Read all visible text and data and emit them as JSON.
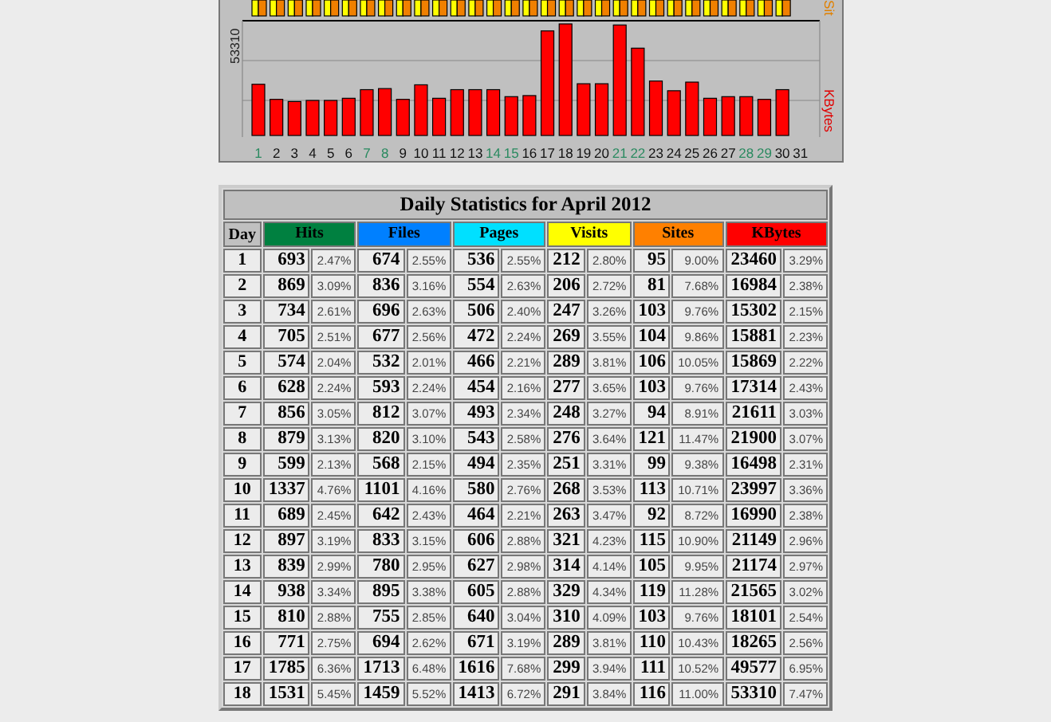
{
  "chart": {
    "y_label": "53310",
    "side_labels": [
      {
        "text": "Sit",
        "color": "#e08000"
      },
      {
        "text": "KBytes",
        "color": "#e00000"
      }
    ],
    "days": [
      {
        "label": "1",
        "weekend": true
      },
      {
        "label": "2",
        "weekend": false
      },
      {
        "label": "3",
        "weekend": false
      },
      {
        "label": "4",
        "weekend": false
      },
      {
        "label": "5",
        "weekend": false
      },
      {
        "label": "6",
        "weekend": false
      },
      {
        "label": "7",
        "weekend": true
      },
      {
        "label": "8",
        "weekend": true
      },
      {
        "label": "9",
        "weekend": false
      },
      {
        "label": "10",
        "weekend": false
      },
      {
        "label": "11",
        "weekend": false
      },
      {
        "label": "12",
        "weekend": false
      },
      {
        "label": "13",
        "weekend": false
      },
      {
        "label": "14",
        "weekend": true
      },
      {
        "label": "15",
        "weekend": true
      },
      {
        "label": "16",
        "weekend": false
      },
      {
        "label": "17",
        "weekend": false
      },
      {
        "label": "18",
        "weekend": false
      },
      {
        "label": "19",
        "weekend": false
      },
      {
        "label": "20",
        "weekend": false
      },
      {
        "label": "21",
        "weekend": true
      },
      {
        "label": "22",
        "weekend": true
      },
      {
        "label": "23",
        "weekend": false
      },
      {
        "label": "24",
        "weekend": false
      },
      {
        "label": "25",
        "weekend": false
      },
      {
        "label": "26",
        "weekend": false
      },
      {
        "label": "27",
        "weekend": false
      },
      {
        "label": "28",
        "weekend": true
      },
      {
        "label": "29",
        "weekend": true
      },
      {
        "label": "30",
        "weekend": false
      },
      {
        "label": "31",
        "weekend": false
      }
    ]
  },
  "table": {
    "title": "Daily Statistics for April 2012",
    "day_header": "Day",
    "columns": [
      {
        "label": "Hits",
        "color": "#008040",
        "colspan": 2
      },
      {
        "label": "Files",
        "color": "#0080ff",
        "colspan": 2
      },
      {
        "label": "Pages",
        "color": "#00e0ff",
        "colspan": 2
      },
      {
        "label": "Visits",
        "color": "#ffff00",
        "colspan": 2
      },
      {
        "label": "Sites",
        "color": "#ff8000",
        "colspan": 2
      },
      {
        "label": "KBytes",
        "color": "#ff0000",
        "colspan": 2
      }
    ],
    "rows": [
      {
        "day": "1",
        "cells": [
          "693",
          "2.47%",
          "674",
          "2.55%",
          "536",
          "2.55%",
          "212",
          "2.80%",
          "95",
          "9.00%",
          "23460",
          "3.29%"
        ]
      },
      {
        "day": "2",
        "cells": [
          "869",
          "3.09%",
          "836",
          "3.16%",
          "554",
          "2.63%",
          "206",
          "2.72%",
          "81",
          "7.68%",
          "16984",
          "2.38%"
        ]
      },
      {
        "day": "3",
        "cells": [
          "734",
          "2.61%",
          "696",
          "2.63%",
          "506",
          "2.40%",
          "247",
          "3.26%",
          "103",
          "9.76%",
          "15302",
          "2.15%"
        ]
      },
      {
        "day": "4",
        "cells": [
          "705",
          "2.51%",
          "677",
          "2.56%",
          "472",
          "2.24%",
          "269",
          "3.55%",
          "104",
          "9.86%",
          "15881",
          "2.23%"
        ]
      },
      {
        "day": "5",
        "cells": [
          "574",
          "2.04%",
          "532",
          "2.01%",
          "466",
          "2.21%",
          "289",
          "3.81%",
          "106",
          "10.05%",
          "15869",
          "2.22%"
        ]
      },
      {
        "day": "6",
        "cells": [
          "628",
          "2.24%",
          "593",
          "2.24%",
          "454",
          "2.16%",
          "277",
          "3.65%",
          "103",
          "9.76%",
          "17314",
          "2.43%"
        ]
      },
      {
        "day": "7",
        "cells": [
          "856",
          "3.05%",
          "812",
          "3.07%",
          "493",
          "2.34%",
          "248",
          "3.27%",
          "94",
          "8.91%",
          "21611",
          "3.03%"
        ]
      },
      {
        "day": "8",
        "cells": [
          "879",
          "3.13%",
          "820",
          "3.10%",
          "543",
          "2.58%",
          "276",
          "3.64%",
          "121",
          "11.47%",
          "21900",
          "3.07%"
        ]
      },
      {
        "day": "9",
        "cells": [
          "599",
          "2.13%",
          "568",
          "2.15%",
          "494",
          "2.35%",
          "251",
          "3.31%",
          "99",
          "9.38%",
          "16498",
          "2.31%"
        ]
      },
      {
        "day": "10",
        "cells": [
          "1337",
          "4.76%",
          "1101",
          "4.16%",
          "580",
          "2.76%",
          "268",
          "3.53%",
          "113",
          "10.71%",
          "23997",
          "3.36%"
        ]
      },
      {
        "day": "11",
        "cells": [
          "689",
          "2.45%",
          "642",
          "2.43%",
          "464",
          "2.21%",
          "263",
          "3.47%",
          "92",
          "8.72%",
          "16990",
          "2.38%"
        ]
      },
      {
        "day": "12",
        "cells": [
          "897",
          "3.19%",
          "833",
          "3.15%",
          "606",
          "2.88%",
          "321",
          "4.23%",
          "115",
          "10.90%",
          "21149",
          "2.96%"
        ]
      },
      {
        "day": "13",
        "cells": [
          "839",
          "2.99%",
          "780",
          "2.95%",
          "627",
          "2.98%",
          "314",
          "4.14%",
          "105",
          "9.95%",
          "21174",
          "2.97%"
        ]
      },
      {
        "day": "14",
        "cells": [
          "938",
          "3.34%",
          "895",
          "3.38%",
          "605",
          "2.88%",
          "329",
          "4.34%",
          "119",
          "11.28%",
          "21565",
          "3.02%"
        ]
      },
      {
        "day": "15",
        "cells": [
          "810",
          "2.88%",
          "755",
          "2.85%",
          "640",
          "3.04%",
          "310",
          "4.09%",
          "103",
          "9.76%",
          "18101",
          "2.54%"
        ]
      },
      {
        "day": "16",
        "cells": [
          "771",
          "2.75%",
          "694",
          "2.62%",
          "671",
          "3.19%",
          "289",
          "3.81%",
          "110",
          "10.43%",
          "18265",
          "2.56%"
        ]
      },
      {
        "day": "17",
        "cells": [
          "1785",
          "6.36%",
          "1713",
          "6.48%",
          "1616",
          "7.68%",
          "299",
          "3.94%",
          "111",
          "10.52%",
          "49577",
          "6.95%"
        ]
      },
      {
        "day": "18",
        "cells": [
          "1531",
          "5.45%",
          "1459",
          "5.52%",
          "1413",
          "6.72%",
          "291",
          "3.84%",
          "116",
          "11.00%",
          "53310",
          "7.47%"
        ]
      }
    ]
  }
}
